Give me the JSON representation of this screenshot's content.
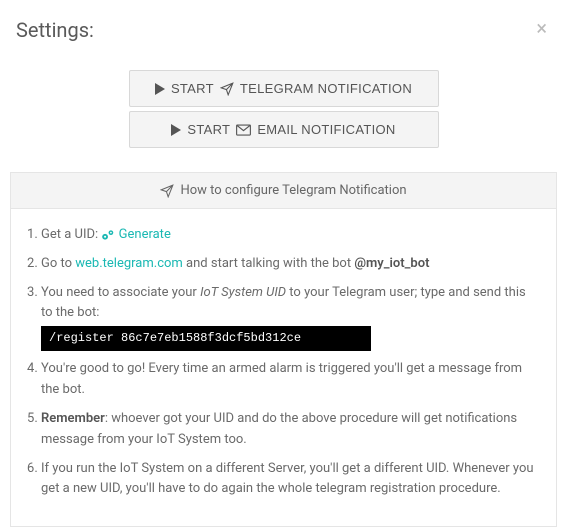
{
  "header": {
    "title": "Settings:"
  },
  "buttons": {
    "start": "START",
    "telegram": "TELEGRAM NOTIFICATION",
    "email": "EMAIL NOTIFICATION"
  },
  "panel": {
    "title": "How to configure Telegram Notification"
  },
  "steps": {
    "s1_prefix": "Get a UID: ",
    "s1_link": "Generate",
    "s2_prefix": "Go to ",
    "s2_link": "web.telegram.com",
    "s2_mid": " and start talking with the bot ",
    "s2_bot": "@my_iot_bot",
    "s3_a": "You need to associate your ",
    "s3_i": "IoT System UID",
    "s3_b": " to your Telegram user; type and send this to the bot:",
    "s3_code": "/register 86c7e7eb1588f3dcf5bd312ce",
    "s4": "You're good to go! Every time an armed alarm is triggered you'll get a message from the bot.",
    "s5_b": "Remember",
    "s5_rest": ": whoever got your UID and do the above procedure will get notifications message from your IoT System too.",
    "s6": "If you run the IoT System on a different Server, you'll get a different UID. Whenever you get a new UID, you'll have to do again the whole telegram registration procedure."
  }
}
